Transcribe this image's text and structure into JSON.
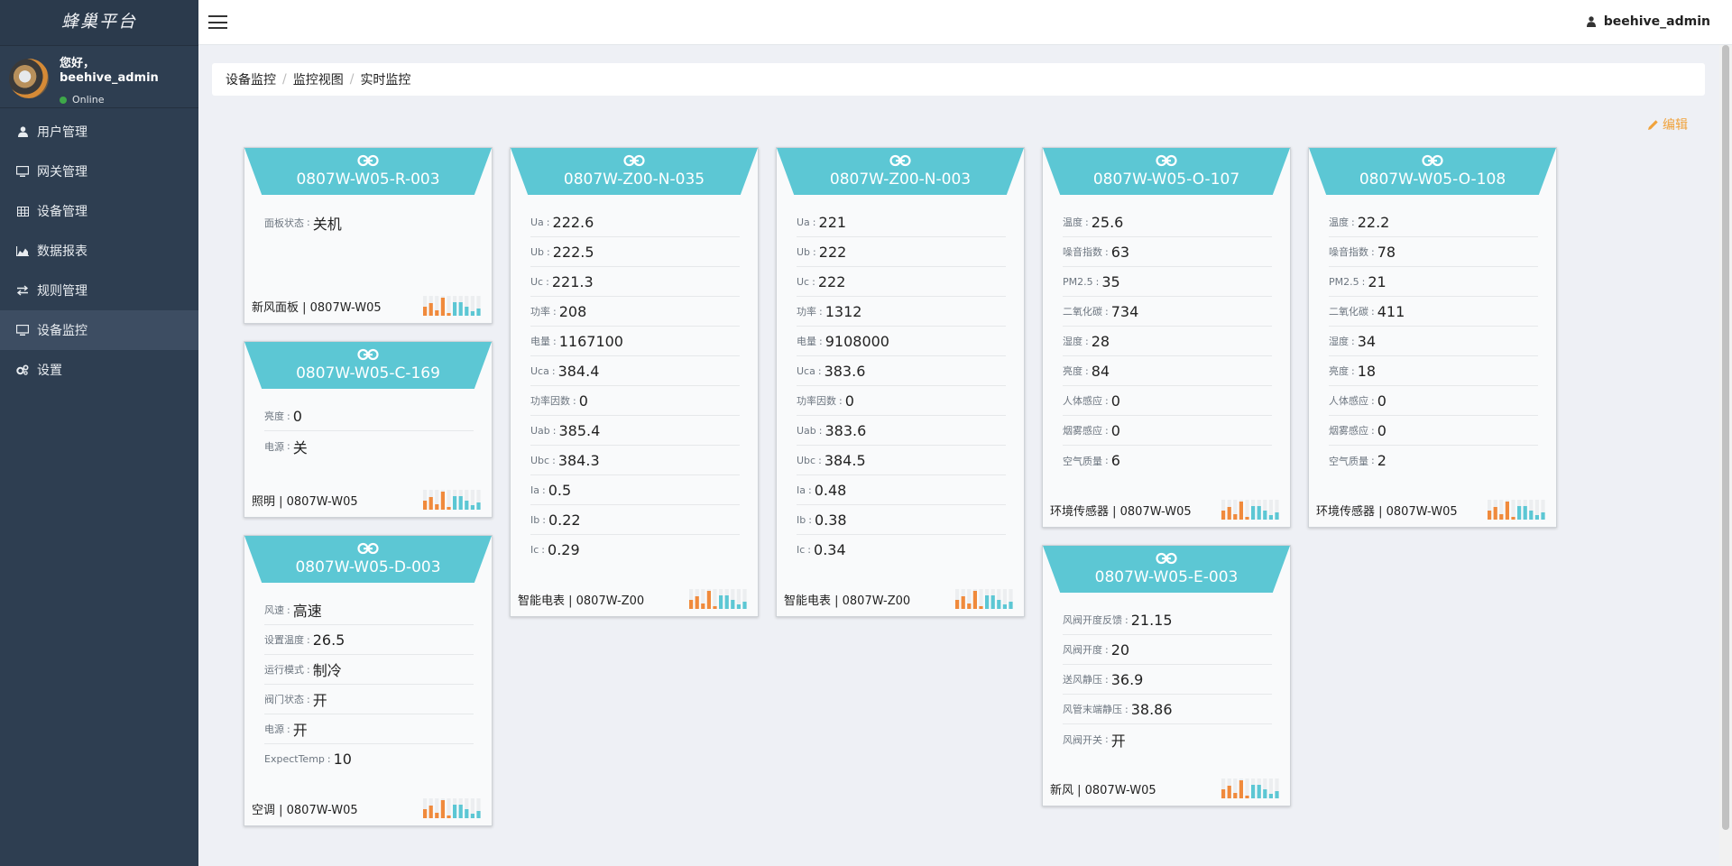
{
  "sidebar": {
    "brand": "蜂巢平台",
    "greeting": "您好，",
    "username": "beehive_admin",
    "status": "Online",
    "items": [
      {
        "label": "用户管理",
        "icon": "user-icon"
      },
      {
        "label": "网关管理",
        "icon": "monitor-icon"
      },
      {
        "label": "设备管理",
        "icon": "table-icon"
      },
      {
        "label": "数据报表",
        "icon": "area-chart-icon"
      },
      {
        "label": "规则管理",
        "icon": "exchange-icon"
      },
      {
        "label": "设备监控",
        "icon": "monitor-icon"
      },
      {
        "label": "设置",
        "icon": "gears-icon"
      }
    ],
    "active_item": "设备监控"
  },
  "header": {
    "username": "beehive_admin"
  },
  "breadcrumb": [
    "设备监控",
    "监控视图",
    "实时监控"
  ],
  "edit_label": "编辑",
  "colors": {
    "card_header": "#5cc7d4",
    "bar_orange": "#f08a3c",
    "bar_teal": "#5cc7d4",
    "edit_link": "#f0a23b",
    "sidebar_bg": "#2e3e51"
  },
  "cards": [
    {
      "title": "0807W-W05-R-003",
      "rows": [
        {
          "k": "面板状态",
          "v": "关机"
        }
      ],
      "footer": "新风面板 | 0807W-W05"
    },
    {
      "title": "0807W-W05-C-169",
      "rows": [
        {
          "k": "亮度",
          "v": "0"
        },
        {
          "k": "电源",
          "v": "关"
        }
      ],
      "footer": "照明 | 0807W-W05"
    },
    {
      "title": "0807W-W05-D-003",
      "rows": [
        {
          "k": "风速",
          "v": "高速"
        },
        {
          "k": "设置温度",
          "v": "26.5"
        },
        {
          "k": "运行模式",
          "v": "制冷"
        },
        {
          "k": "阀门状态",
          "v": "开"
        },
        {
          "k": "电源",
          "v": "开"
        },
        {
          "k": "ExpectTemp",
          "v": "10"
        }
      ],
      "footer": "空调 | 0807W-W05"
    },
    {
      "title": "0807W-Z00-N-035",
      "rows": [
        {
          "k": "Ua",
          "v": "222.6"
        },
        {
          "k": "Ub",
          "v": "222.5"
        },
        {
          "k": "Uc",
          "v": "221.3"
        },
        {
          "k": "功率",
          "v": "208"
        },
        {
          "k": "电量",
          "v": "1167100"
        },
        {
          "k": "Uca",
          "v": "384.4"
        },
        {
          "k": "功率因数",
          "v": "0"
        },
        {
          "k": "Uab",
          "v": "385.4"
        },
        {
          "k": "Ubc",
          "v": "384.3"
        },
        {
          "k": "Ia",
          "v": "0.5"
        },
        {
          "k": "Ib",
          "v": "0.22"
        },
        {
          "k": "Ic",
          "v": "0.29"
        }
      ],
      "footer": "智能电表 | 0807W-Z00"
    },
    {
      "title": "0807W-Z00-N-003",
      "rows": [
        {
          "k": "Ua",
          "v": "221"
        },
        {
          "k": "Ub",
          "v": "222"
        },
        {
          "k": "Uc",
          "v": "222"
        },
        {
          "k": "功率",
          "v": "1312"
        },
        {
          "k": "电量",
          "v": "9108000"
        },
        {
          "k": "Uca",
          "v": "383.6"
        },
        {
          "k": "功率因数",
          "v": "0"
        },
        {
          "k": "Uab",
          "v": "383.6"
        },
        {
          "k": "Ubc",
          "v": "384.5"
        },
        {
          "k": "Ia",
          "v": "0.48"
        },
        {
          "k": "Ib",
          "v": "0.38"
        },
        {
          "k": "Ic",
          "v": "0.34"
        }
      ],
      "footer": "智能电表 | 0807W-Z00"
    },
    {
      "title": "0807W-W05-O-107",
      "rows": [
        {
          "k": "温度",
          "v": "25.6"
        },
        {
          "k": "噪音指数",
          "v": "63"
        },
        {
          "k": "PM2.5",
          "v": "35"
        },
        {
          "k": "二氧化碳",
          "v": "734"
        },
        {
          "k": "湿度",
          "v": "28"
        },
        {
          "k": "亮度",
          "v": "84"
        },
        {
          "k": "人体感应",
          "v": "0"
        },
        {
          "k": "烟雾感应",
          "v": "0"
        },
        {
          "k": "空气质量",
          "v": "6"
        }
      ],
      "footer": "环境传感器 | 0807W-W05"
    },
    {
      "title": "0807W-W05-E-003",
      "rows": [
        {
          "k": "风阀开度反馈",
          "v": "21.15"
        },
        {
          "k": "风阀开度",
          "v": "20"
        },
        {
          "k": "送风静压",
          "v": "36.9"
        },
        {
          "k": "风管末端静压",
          "v": "38.86"
        },
        {
          "k": "风阀开关",
          "v": "开"
        }
      ],
      "footer": "新风 | 0807W-W05"
    },
    {
      "title": "0807W-W05-O-108",
      "rows": [
        {
          "k": "温度",
          "v": "22.2"
        },
        {
          "k": "噪音指数",
          "v": "78"
        },
        {
          "k": "PM2.5",
          "v": "21"
        },
        {
          "k": "二氧化碳",
          "v": "411"
        },
        {
          "k": "湿度",
          "v": "34"
        },
        {
          "k": "亮度",
          "v": "18"
        },
        {
          "k": "人体感应",
          "v": "0"
        },
        {
          "k": "烟雾感应",
          "v": "0"
        },
        {
          "k": "空气质量",
          "v": "2"
        }
      ],
      "footer": "环境传感器 | 0807W-W05"
    }
  ]
}
